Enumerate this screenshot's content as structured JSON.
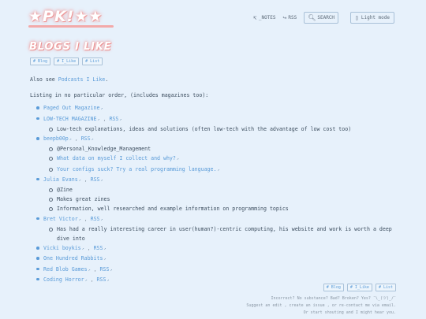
{
  "site": {
    "logo_text": "★PK!★★"
  },
  "nav": {
    "notes": "_NOTES",
    "rss": "RSS",
    "search": "SEARCH",
    "light_mode": "Light mode"
  },
  "page": {
    "title": "BLOGS I LIKE",
    "crumbs": [
      "# Blog",
      "# I_Like",
      "# List"
    ]
  },
  "intro": {
    "prefix": "Also see ",
    "link": "Podcasts I Like",
    "suffix": ".",
    "listing": "Listing in no particular order, (includes magazines too):"
  },
  "blogs": [
    {
      "name": "Paged Out Magazine",
      "rss": "",
      "notes": []
    },
    {
      "name": "LOW-TECH MAGAZINE",
      "rss": "RSS",
      "notes": [
        {
          "text": "Low-tech explanations, ideas and solutions (often low-tech with the advantage of low cost too)",
          "link": false
        }
      ]
    },
    {
      "name": "beepb00p",
      "rss": "RSS",
      "notes": [
        {
          "text": "@Personal_Knowledge_Management",
          "link": false
        },
        {
          "text": "What data on myself I collect and why?",
          "link": true
        },
        {
          "text": "Your configs suck? Try a real programming language.",
          "link": true
        }
      ]
    },
    {
      "name": "Julia Evans",
      "rss": "RSS",
      "notes": [
        {
          "text": "@Zine",
          "link": false
        },
        {
          "text": "Makes great zines",
          "link": false
        },
        {
          "text": "Information, well researched and example information on programming topics",
          "link": false
        }
      ]
    },
    {
      "name": "Bret Victor",
      "rss": "RSS",
      "notes": [
        {
          "text": "Has had a really interesting career in user(human?)-centric computing, his website and work is worth a deep dive into",
          "link": false
        }
      ]
    },
    {
      "name": "Vicki boykis",
      "rss": "RSS",
      "notes": []
    },
    {
      "name": "One Hundred Rabbits",
      "rss": "",
      "notes": []
    },
    {
      "name": "Red Blob Games",
      "rss": "RSS",
      "notes": []
    },
    {
      "name": "Coding Horror",
      "rss": "RSS",
      "notes": []
    }
  ],
  "footer": {
    "line1": "Incorrect? No substance? Bad? Broken? Yes? ¯\\_(ツ)_/¯",
    "line2": "Suggest an edit , create an issue , or re-contact me via email.",
    "line3": "Or start shouting and I might hear you."
  },
  "colors": {
    "accent": "#5a9bd8",
    "background": "#e7f1fb",
    "title_glow": "#f19595"
  }
}
